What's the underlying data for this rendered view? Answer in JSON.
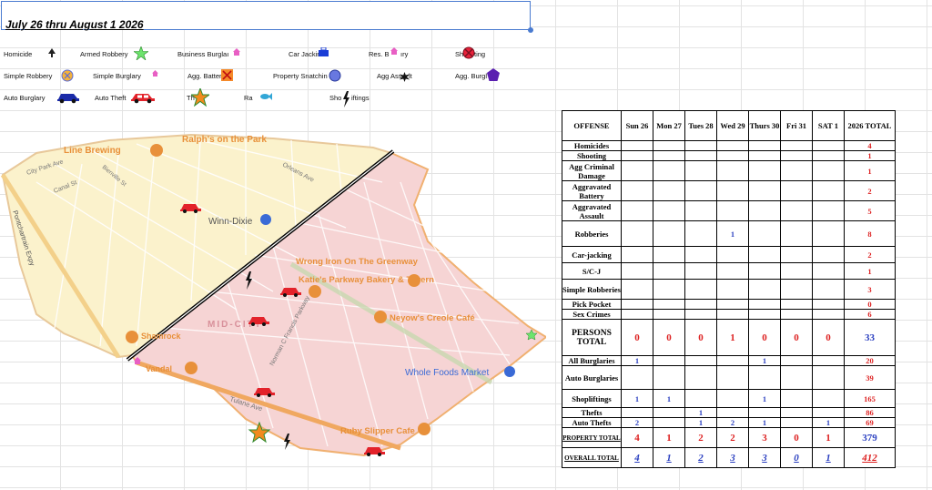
{
  "title": "July 26 thru August 1 2026",
  "legend": [
    {
      "label": "Homicide",
      "icon": "tree-icon"
    },
    {
      "label": "Armed Robbery",
      "icon": "green-star-icon"
    },
    {
      "label": "Business Burglaı",
      "icon": "pink-house-icon"
    },
    {
      "label": "Car Jackin",
      "icon": "blue-bag-icon"
    },
    {
      "label": "Res. B",
      "icon": "pink-house-icon"
    },
    {
      "label": "ıry",
      "icon": ""
    },
    {
      "label": "Sh",
      "icon": "red-circle-x-icon"
    },
    {
      "label": "ting",
      "icon": ""
    },
    {
      "label": "Simple Robbery",
      "icon": "orange-circle-x-icon"
    },
    {
      "label": "Simple Burglary",
      "icon": "pink-house-icon"
    },
    {
      "label": "Agg. Batter",
      "icon": "orange-square-x-icon"
    },
    {
      "label": "Property Snatchin",
      "icon": "blue-circle-icon"
    },
    {
      "label": "Agg Ass",
      "icon": "black-burst-icon"
    },
    {
      "label": "lt",
      "icon": ""
    },
    {
      "label": "Agg. Burgl",
      "icon": "purple-pentagon-icon"
    },
    {
      "label": "Auto Burglary",
      "icon": "blue-car-icon"
    },
    {
      "label": "Auto Theft",
      "icon": "red-car-icon"
    },
    {
      "label": "Th",
      "icon": "orange-star-icon"
    },
    {
      "label": "Ra",
      "icon": "blue-fish-icon"
    },
    {
      "label": "Sho",
      "icon": "lightning-icon"
    },
    {
      "label": "iftings",
      "icon": ""
    }
  ],
  "map": {
    "labels": [
      "Ralph's on the Park",
      "Line Brewing",
      "City Park Ave",
      "Canal St",
      "Bienville St",
      "Orleans Ave",
      "Winn-Dixie",
      "Wrong Iron On The Greenway",
      "Katie's Parkway Bakery & Tavern",
      "MID-CITY",
      "Neyow's Creole Café",
      "Shamrock",
      "Vandal",
      "Whole Foods Market",
      "Tulane Ave",
      "Ruby Slipper Cafe",
      "Pontchartrain Expy",
      "Norman C Francis Parkway"
    ],
    "colors": {
      "north_zone": "#fbf2cc",
      "south_zone": "#f6d4d4",
      "boundary": "#000000",
      "label": "#e8903a"
    }
  },
  "table": {
    "headers": [
      "OFFENSE",
      "Sun 26",
      "Mon 27",
      "Tues 28",
      "Wed 29",
      "Thurs 30",
      "Fri 31",
      "SAT 1",
      "2026 TOTAL"
    ],
    "rows": [
      {
        "offense": "Homicides",
        "days": [
          "",
          "",
          "",
          "",
          "",
          "",
          ""
        ],
        "total": "4"
      },
      {
        "offense": "Shooting",
        "days": [
          "",
          "",
          "",
          "",
          "",
          "",
          ""
        ],
        "total": "1"
      },
      {
        "offense": "Agg Criminal Damage",
        "days": [
          "",
          "",
          "",
          "",
          "",
          "",
          ""
        ],
        "total": "1"
      },
      {
        "offense": "Aggravated Battery",
        "days": [
          "",
          "",
          "",
          "",
          "",
          "",
          ""
        ],
        "total": "2"
      },
      {
        "offense": "Aggravated Assault",
        "days": [
          "",
          "",
          "",
          "",
          "",
          "",
          ""
        ],
        "total": "5"
      },
      {
        "offense": "Robberies",
        "days": [
          "",
          "",
          "",
          "1",
          "",
          "",
          ""
        ],
        "total": "8"
      },
      {
        "offense": "Car-jacking",
        "days": [
          "",
          "",
          "",
          "",
          "",
          "",
          ""
        ],
        "total": "2"
      },
      {
        "offense": "S/C-J",
        "days": [
          "",
          "",
          "",
          "",
          "",
          "",
          ""
        ],
        "total": "1"
      },
      {
        "offense": "Simple Robberies",
        "days": [
          "",
          "",
          "",
          "",
          "",
          "",
          ""
        ],
        "total": "3"
      },
      {
        "offense": "Pick Pocket",
        "days": [
          "",
          "",
          "",
          "",
          "",
          "",
          ""
        ],
        "total": "0"
      },
      {
        "offense": "Sex Crimes",
        "days": [
          "",
          "",
          "",
          "",
          "",
          "",
          ""
        ],
        "total": "6"
      },
      {
        "offense": "PERSONS TOTAL",
        "days": [
          "0",
          "0",
          "0",
          "1",
          "0",
          "0",
          "0"
        ],
        "total": "33"
      },
      {
        "offense": "All Burglaries",
        "days": [
          "1",
          "",
          "",
          "",
          "1",
          "",
          ""
        ],
        "total": "20"
      },
      {
        "offense": "Auto Burglaries",
        "days": [
          "",
          "",
          "",
          "",
          "",
          "",
          ""
        ],
        "total": "39"
      },
      {
        "offense": "Shopliftings",
        "days": [
          "1",
          "1",
          "",
          "",
          "1",
          "",
          ""
        ],
        "total": "165"
      },
      {
        "offense": "Thefts",
        "days": [
          "",
          "",
          "1",
          "",
          "",
          "",
          ""
        ],
        "total": "86"
      },
      {
        "offense": "Auto Thefts",
        "days": [
          "2",
          "",
          "1",
          "2",
          "1",
          "",
          "1"
        ],
        "total": "69"
      },
      {
        "offense": "PROPERTY TOTAL",
        "days": [
          "4",
          "1",
          "2",
          "2",
          "3",
          "0",
          "1"
        ],
        "total": "379"
      },
      {
        "offense": "OVERALL TOTAL",
        "days": [
          "4",
          "1",
          "2",
          "3",
          "3",
          "0",
          "1"
        ],
        "total": "412"
      }
    ]
  }
}
